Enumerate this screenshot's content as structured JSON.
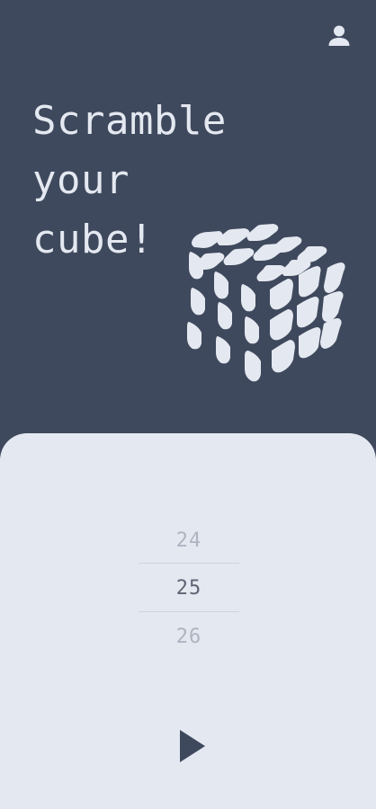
{
  "header": {
    "account_icon": "account-icon"
  },
  "hero": {
    "title_lines": [
      "Scramble",
      "your",
      "cube!"
    ],
    "illustration": "rubiks-cube-icon"
  },
  "picker": {
    "values": [
      "24",
      "25",
      "26"
    ],
    "selected": "25"
  },
  "actions": {
    "play_icon": "play-icon"
  },
  "colors": {
    "background": "#3f495d",
    "sheet": "#e4e8f0",
    "text_light": "#e4e8f0",
    "picker_selected": "#5d6473",
    "picker_dim": "#aeb4c0",
    "accent": "#3f495d"
  }
}
